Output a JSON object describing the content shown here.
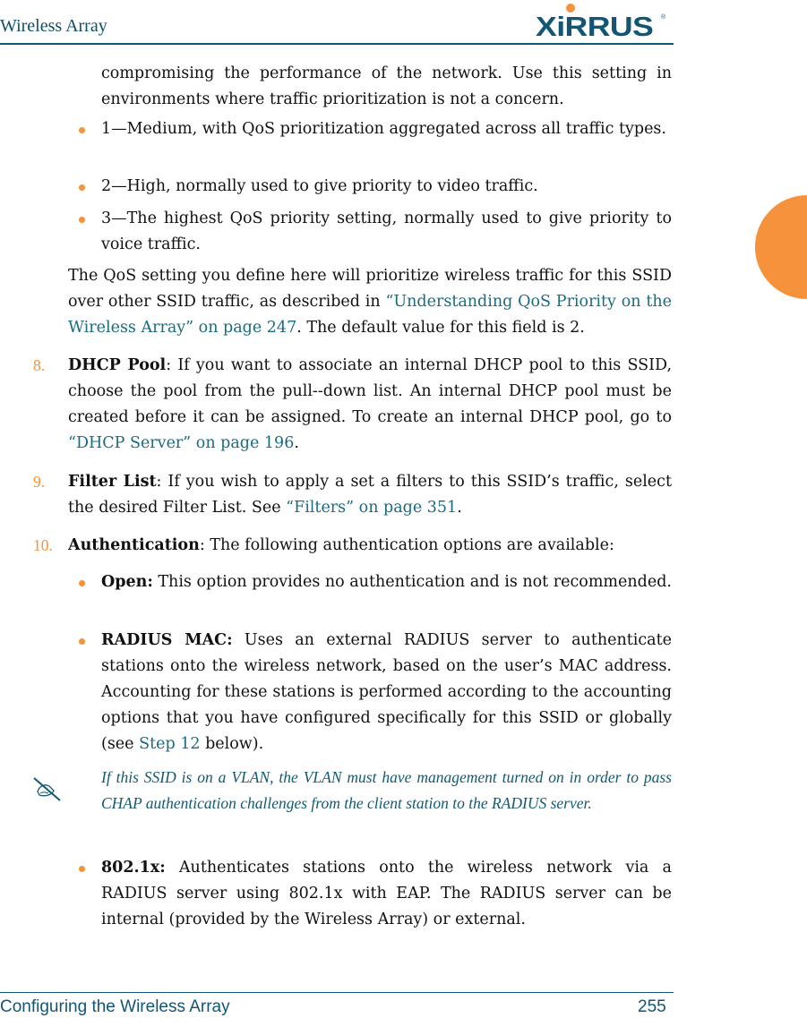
{
  "header": {
    "title": "Wireless Array",
    "logo_text": "XiRRUS",
    "logo_reg": "®"
  },
  "colors": {
    "accent_orange": "#f5923b",
    "brand_teal": "#135674",
    "link": "#1a6b80"
  },
  "body": {
    "intro": "compromising the performance of the network. Use this setting in environments where traffic prioritization is not a concern.",
    "qos_bullets": [
      "1—Medium, with QoS prioritization aggregated across all traffic types.",
      "2—High, normally used to give priority to video traffic.",
      "3—The highest QoS priority setting, normally used to give priority to voice traffic."
    ],
    "qos_para": {
      "before": "The QoS setting you define here will prioritize wireless traffic for this SSID over other SSID traffic, as described in ",
      "link": "“Understanding QoS Priority on the Wireless Array” on page 247",
      "after": ". The default value for this field is 2."
    },
    "steps": [
      {
        "number": "8.",
        "term": "DHCP Pool",
        "text": ": If you want to associate an internal DHCP pool to this SSID, choose the pool from the pull--down list. An internal DHCP pool must be created before it can be assigned. To create an internal DHCP pool, go to ",
        "link": "“DHCP Server” on page 196",
        "after": "."
      },
      {
        "number": "9.",
        "term": "Filter List",
        "text": ": If you wish to apply a set a filters to this SSID’s traffic, select the desired Filter List. See ",
        "link": "“Filters” on page 351",
        "after": "."
      },
      {
        "number": "10.",
        "term": "Authentication",
        "text": ": The following authentication options are available:"
      }
    ],
    "auth_options": [
      {
        "term": "Open:",
        "text": " This option provides no authentication and is not recommended."
      },
      {
        "term": "RADIUS MAC:",
        "text": " Uses an external RADIUS server to authenticate stations onto the wireless network, based on the user’s MAC address. Accounting for these stations is performed according to the accounting options that you have configured specifically for this SSID or globally (see ",
        "link": "Step 12",
        "after": " below)."
      },
      {
        "term": "802.1x:",
        "text": " Authenticates stations onto the wireless network via a RADIUS server using 802.1x with EAP. The RADIUS server can be internal (provided by the Wireless Array) or external."
      }
    ],
    "note": {
      "icon": "pencil-note-icon",
      "text": "If this SSID is on a VLAN, the VLAN must have management turned on in order to pass CHAP authentication challenges from the client station to the RADIUS server."
    }
  },
  "footer": {
    "section": "Configuring the Wireless Array",
    "page_number": "255"
  }
}
